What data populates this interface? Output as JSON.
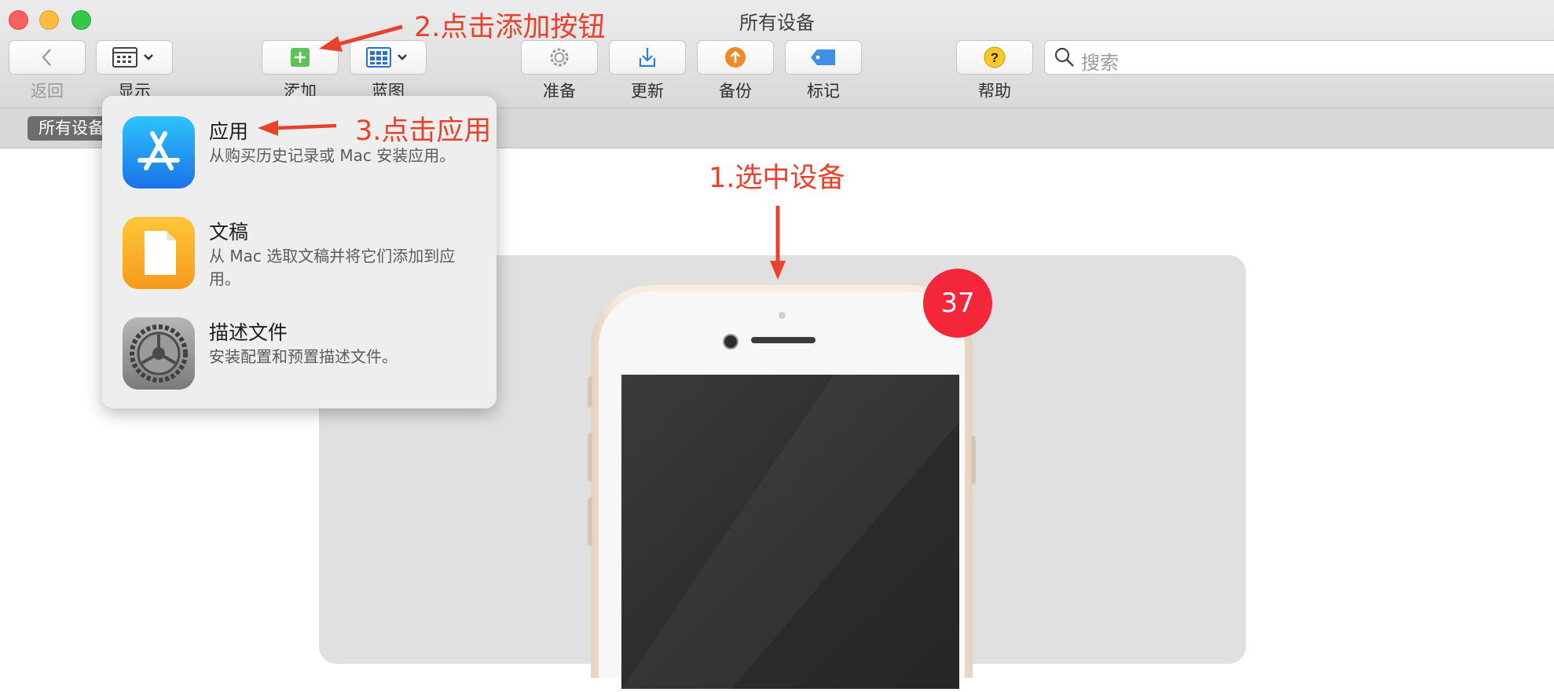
{
  "window": {
    "title": "所有设备"
  },
  "toolbar": {
    "back_label": "返回",
    "display_label": "显示",
    "add_label": "添加",
    "blueprint_label": "蓝图",
    "prepare_label": "准备",
    "update_label": "更新",
    "backup_label": "备份",
    "tag_label": "标记",
    "help_label": "帮助",
    "help_glyph": "?"
  },
  "search": {
    "placeholder": "搜索"
  },
  "breadcrumb": {
    "label": "所有设备"
  },
  "add_menu": {
    "items": [
      {
        "title": "应用",
        "description": "从购买历史记录或 Mac 安装应用。",
        "icon": "app-store-icon"
      },
      {
        "title": "文稿",
        "description": "从 Mac 选取文稿并将它们添加到应用。",
        "icon": "document-icon"
      },
      {
        "title": "描述文件",
        "description": "安装配置和预置描述文件。",
        "icon": "settings-gear-icon"
      }
    ]
  },
  "device": {
    "badge_count": "37"
  },
  "annotations": {
    "step1": "1.选中设备",
    "step2": "2.点击添加按钮",
    "step3": "3.点击应用"
  },
  "colors": {
    "annotation": "#e8412c",
    "badge": "#f4263a",
    "accent_blue": "#1a8cf5",
    "add_green": "#5fc35c"
  }
}
